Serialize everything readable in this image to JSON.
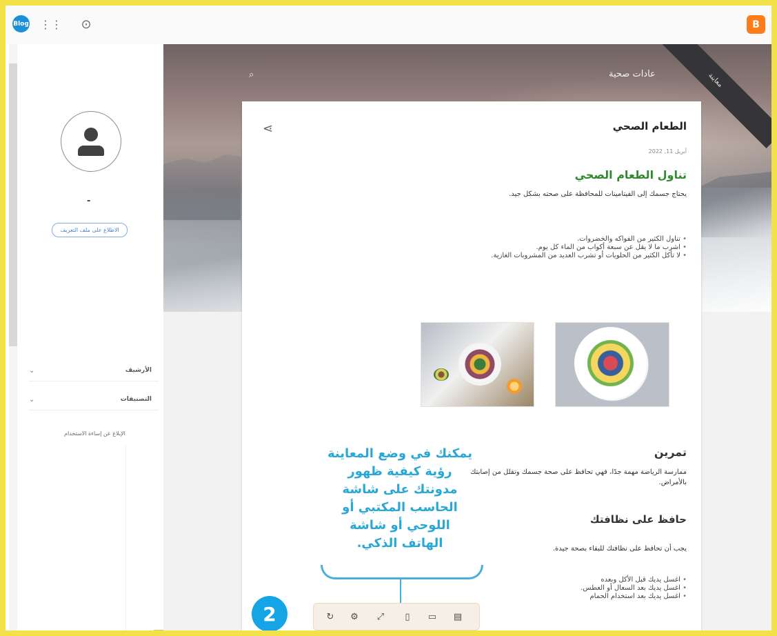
{
  "top_bar": {
    "profile_text": "Blog",
    "grid_icon": "apps-grid-icon",
    "help_icon": "help-circle-icon",
    "logo_text": "B",
    "logo_color": "#ff7c1b"
  },
  "sidebar": {
    "username": "-",
    "view_profile_label": "الاطلاع على ملف التعريف",
    "archive_label": "الأرشيف",
    "labels_label": "التصنيفات",
    "report_link": "الإبلاغ عن إساءة الاستخدام"
  },
  "hero": {
    "blog_title": "عادات صحية",
    "search_icon": "search-icon",
    "ribbon_text": "معاينة"
  },
  "post": {
    "title": "الطعام الصحي",
    "date": "أبريل 11, 2022",
    "heading_1": "تناول الطعام الصحي",
    "intro": "يحتاج جسمك إلى الفيتامينات للمحافظة على صحته بشكل جيد.",
    "bullets_top": [
      "تناول الكثير من الفواكه والخضروات.",
      "اشرب ما لا يقل عن سبعة أكواب من الماء كل يوم.",
      "لا تأكل الكثير من الحلويات أو تشرب العديد من المشروبات الغازية."
    ],
    "exercise_title": "تمرين",
    "exercise_text": "ممارسة الرياضة مهمة جدًا، فهي تحافظ على صحة جسمك وتقلل من إصابتك بالأمراض.",
    "clean_title": "حافظ على نظافتك",
    "clean_text": "يجب أن تحافظ على نظافتك للبقاء بصحة جيدة.",
    "bullets_bottom": [
      "اغسل يديك قبل الأكل وبعده",
      "اغسل يديك بعد السعال أو العطس.",
      "اغسل يديك بعد استخدام الحمام"
    ]
  },
  "callout": {
    "text": "يمكنك في وضع المعاينة رؤية كيفية ظهور مدونتك على شاشة الحاسب المكتبي أو اللوحي أو شاشة الهاتف الذكي.",
    "step_number": "2",
    "accent_color": "#29a7d7"
  },
  "device_toolbar": {
    "icons": [
      "refresh-icon",
      "settings-icon",
      "expand-icon",
      "phone-icon",
      "tablet-icon",
      "desktop-icon"
    ]
  }
}
